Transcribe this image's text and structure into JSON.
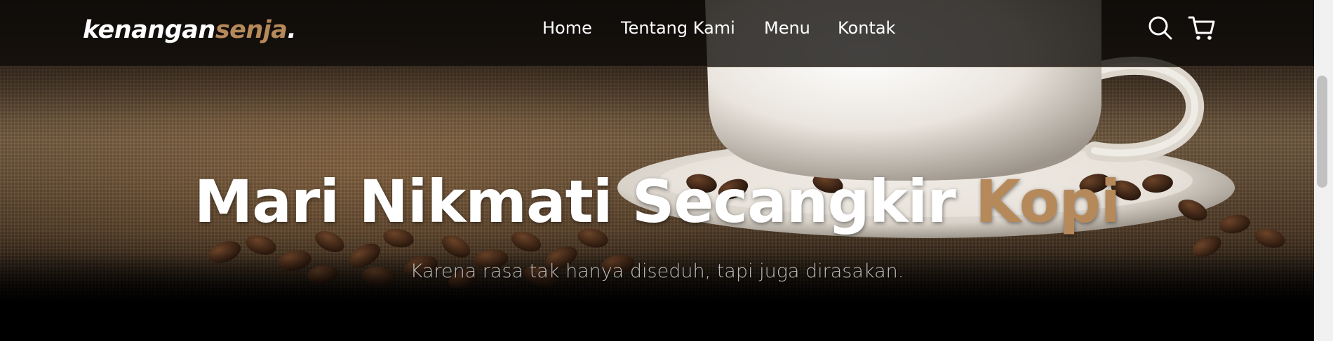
{
  "navbar": {
    "logo": {
      "main": "kenangan",
      "accent": "senja",
      "dot": "."
    },
    "links": [
      {
        "label": "Home"
      },
      {
        "label": "Tentang Kami"
      },
      {
        "label": "Menu"
      },
      {
        "label": "Kontak"
      }
    ],
    "icons": [
      "search-icon",
      "cart-icon"
    ]
  },
  "hero": {
    "title_main": "Mari Nikmati Secangkir",
    "title_accent": "Kopi",
    "subtitle": "Karena rasa tak hanya diseduh, tapi juga dirasakan."
  },
  "colors": {
    "accent": "#b6895b",
    "navbar_bg": "#0e0b09",
    "text": "#ffffff"
  }
}
